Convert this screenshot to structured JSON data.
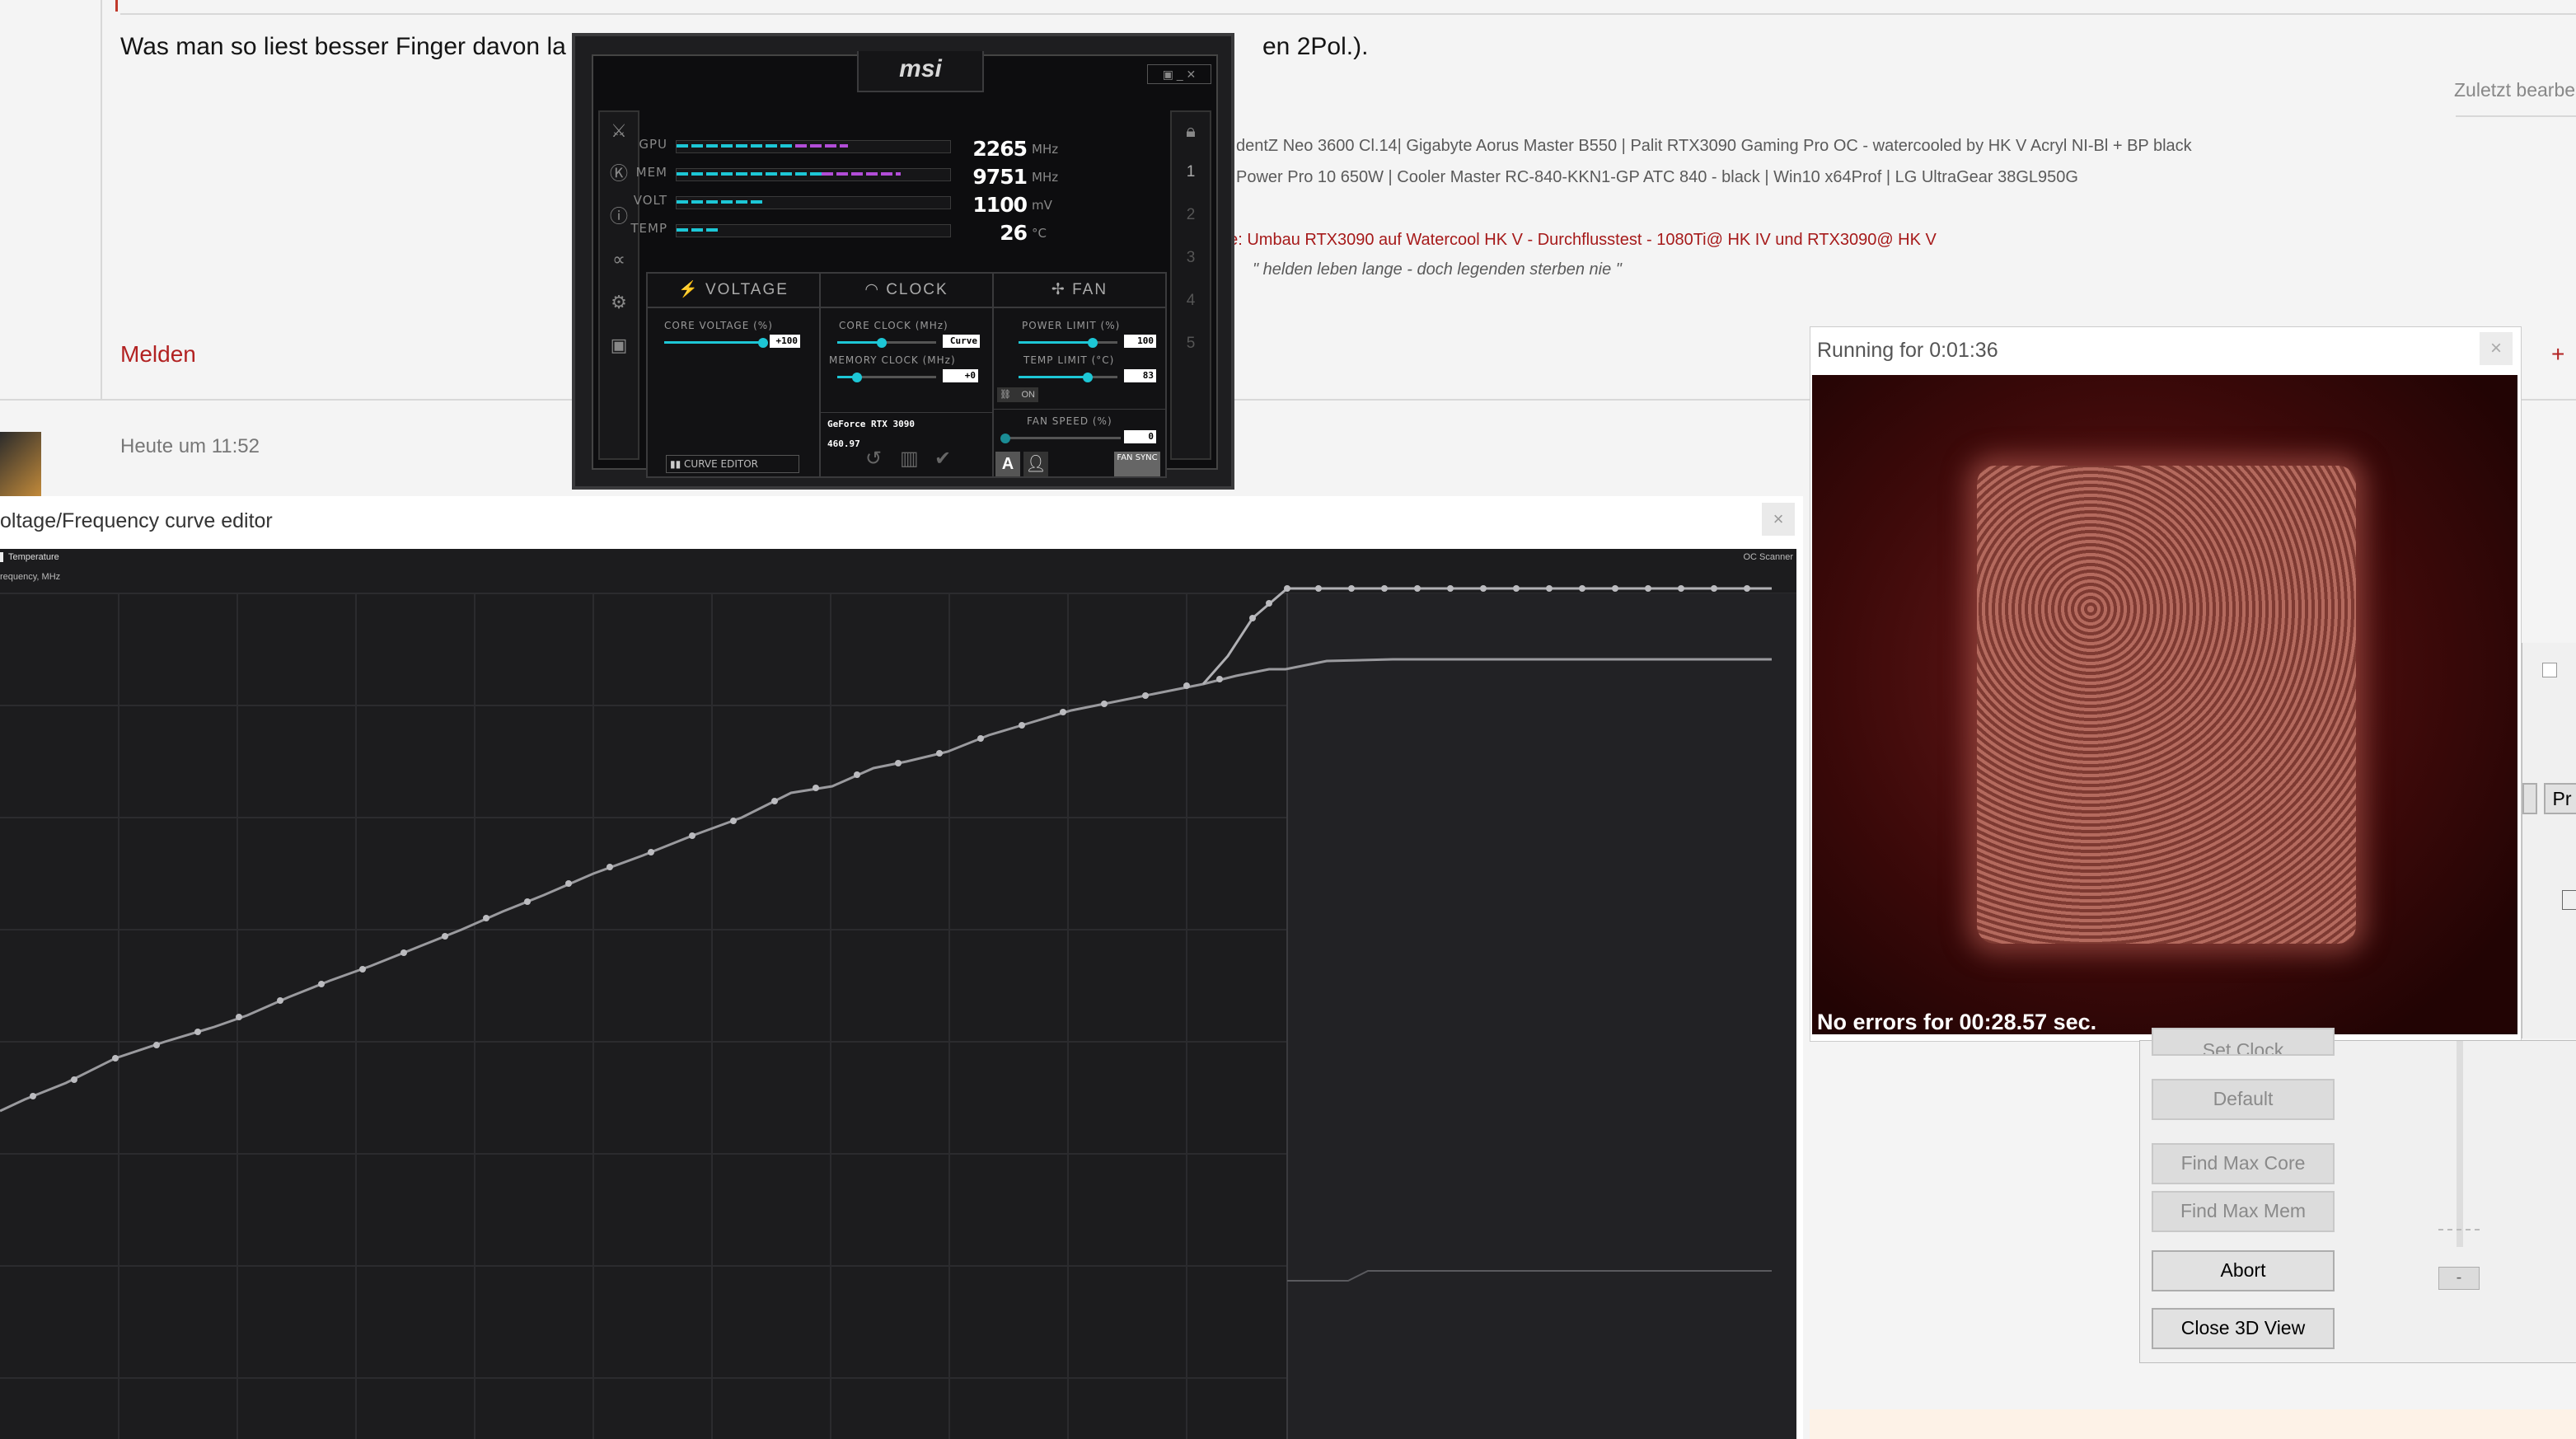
{
  "forum": {
    "post_text_left": "Was man so liest besser Finger davon la",
    "post_text_right": "en 2Pol.).",
    "last_edited": "Zuletzt bearbe",
    "sig1": "dentZ Neo 3600 Cl.14| Gigabyte Aorus Master B550 | Palit RTX3090 Gaming Pro OC - watercooled by HK V Acryl NI-Bl + BP black",
    "sig2": "Power Pro 10 650W | Cooler Master RC-840-KKN1-GP ATC 840 - black | Win10 x64Prof | LG UltraGear 38GL950G",
    "sig3": "rie: Umbau RTX3090 auf Watercool HK V - Durchflusstest - 1080Ti@ HK IV und RTX3090@ HK V",
    "sig4": "\" helden leben lange - doch legenden sterben nie \"",
    "report_link": "Melden",
    "plus_link": "+",
    "timestamp": "Heute um 11:52"
  },
  "afterburner": {
    "logo": "msi",
    "stats": [
      {
        "label": "GPU",
        "value": "2265",
        "unit": "MHz",
        "fill": 0.45,
        "fill2": 0.2
      },
      {
        "label": "MEM",
        "value": "9751",
        "unit": "MHz",
        "fill": 0.55,
        "fill2": 0.3
      },
      {
        "label": "VOLT",
        "value": "1100",
        "unit": "mV",
        "fill": 0.33,
        "fill2": 0
      },
      {
        "label": "TEMP",
        "value": "26",
        "unit": "°C",
        "fill": 0.16,
        "fill2": 0
      }
    ],
    "panels": {
      "voltage": "VOLTAGE",
      "clock": "CLOCK",
      "fan": "FAN"
    },
    "voltage": {
      "label": "CORE VOLTAGE (%)",
      "value": "+100",
      "level": 1.0
    },
    "core_clock": {
      "label": "CORE CLOCK (MHz)",
      "value": "Curve",
      "level": 0.45
    },
    "memory_clock": {
      "label": "MEMORY CLOCK (MHz)",
      "value": "+0",
      "level": 0.2
    },
    "power_limit": {
      "label": "POWER LIMIT (%)",
      "value": "100",
      "level": 0.75
    },
    "temp_limit": {
      "label": "TEMP LIMIT (°C)",
      "value": "83",
      "level": 0.7
    },
    "fan_speed": {
      "label": "FAN SPEED (%)",
      "value": "0",
      "level": 0.0
    },
    "link_toggle": "ON",
    "gpu_name": "GeForce RTX 3090",
    "driver": "460.97",
    "curve_editor_button": "CURVE EDITOR",
    "fan_sync_button": "FAN SYNC",
    "auto_button": "A",
    "profiles": [
      "1",
      "2",
      "3",
      "4",
      "5"
    ]
  },
  "curve_editor": {
    "title": "oltage/Frequency curve editor",
    "close": "×",
    "legend_temperature": "Temperature",
    "y_axis_label": "requency, MHz",
    "oc_scanner": "OC Scanner"
  },
  "run_window": {
    "title": "Running for 0:01:36",
    "close": "×",
    "status": "No errors for 00:28.57 sec."
  },
  "scanner_buttons": {
    "set_clock": "Set Clock",
    "default": "Default",
    "find_max_core": "Find Max Core",
    "find_max_mem": "Find Max Mem",
    "abort": "Abort",
    "close_3d": "Close 3D View",
    "pr_button": "Pr",
    "minus_button": "-"
  }
}
